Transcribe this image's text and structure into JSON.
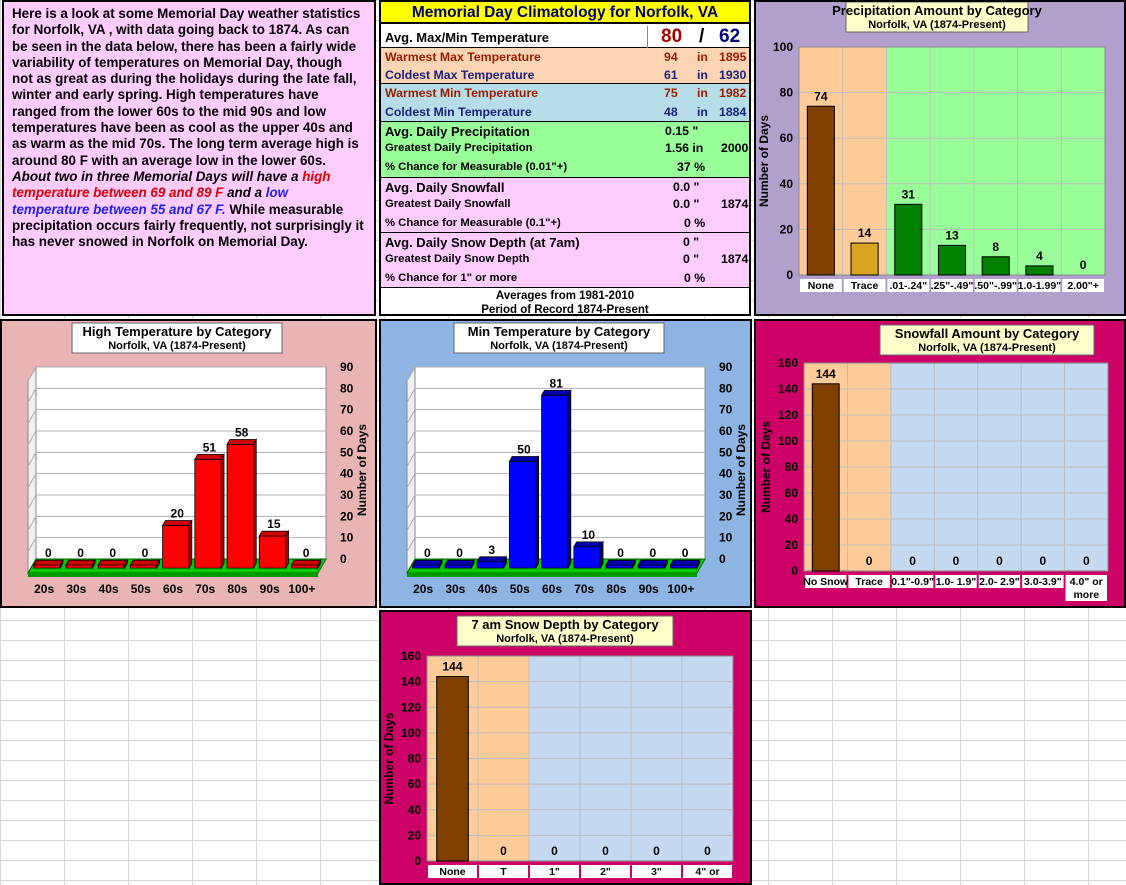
{
  "intro": {
    "part1": "Here is a look at some Memorial Day weather statistics for Norfolk, VA , with data going back to 1874. As can be seen in the data below, there has been a fairly wide variability of temperatures on Memorial Day, though not as great as during the holidays during the late fall, winter and early spring. High temperatures have ranged from the lower 60s to the mid 90s and low temperatures have been as cool as the upper 40s and as warm as the mid 70s. The long term average high is around 80 F with an average low in the lower 60s. ",
    "italic1": "About two in three Memorial Days will have a ",
    "red": "high temperature between 69 and 89 F",
    "italic2": " and a ",
    "blue": "low temperature between 55 and 67 F.",
    "part2": " While measurable precipitation occurs fairly frequently, not surprisingly it has never snowed in Norfolk on Memorial Day."
  },
  "climatology": {
    "title": "Memorial Day Climatology for Norfolk, VA",
    "avg_maxmin_label": "Avg. Max/Min Temperature",
    "avg_max": "80",
    "slash": "/",
    "avg_min": "62",
    "rows_temp": [
      {
        "label": "Warmest Max Temperature",
        "value": "94",
        "in": "in",
        "year": "1895"
      },
      {
        "label": "Coldest Max Temperature",
        "value": "61",
        "in": "in",
        "year": "1930"
      },
      {
        "label": "Warmest Min Temperature",
        "value": "75",
        "in": "in",
        "year": "1982"
      },
      {
        "label": "Coldest Min Temperature",
        "value": "48",
        "in": "in",
        "year": "1884"
      }
    ],
    "precip": {
      "avg_label": "Avg. Daily Precipitation",
      "avg_value": "0.15 \"",
      "greatest_label": "Greatest Daily Precipitation",
      "greatest_value": "1.56 in",
      "greatest_year": "2000",
      "chance_label": "% Chance for Measurable (0.01\"+)",
      "chance_value": "37 %"
    },
    "snow": {
      "avg_label": "Avg. Daily Snowfall",
      "avg_value": "0.0 \"",
      "greatest_label": "Greatest Daily Snowfall",
      "greatest_value": "0.0 \"",
      "greatest_year": "1874",
      "chance_label": "% Chance for Measurable (0.1\"+)",
      "chance_value": "0 %"
    },
    "depth": {
      "avg_label": "Avg. Daily Snow Depth (at 7am)",
      "avg_value": "0 \"",
      "greatest_label": "Greatest Daily Snow Depth",
      "greatest_value": "0 \"",
      "greatest_year": "1874",
      "chance_label": "% Chance for 1\" or more",
      "chance_value": "0 %"
    },
    "footer1": "Averages from 1981-2010",
    "footer2": "Period of Record 1874-Present"
  },
  "colors": {
    "intro_bg": "#ffccff",
    "precip_panel": "#b19fcc",
    "high_panel": "#e8b4b4",
    "min_panel": "#8eb4e3",
    "snow_panel": "#cc0066",
    "precip_green": "#99ff99",
    "trace_orange": "#ffcc99",
    "snow_blue": "#c5d9f1",
    "brown_bar": "#7f3f00",
    "red_bar": "#ff0000",
    "blue_bar": "#0000ff",
    "green_bar": "#008000",
    "gold_bar": "#daa520"
  },
  "chart_data": [
    {
      "type": "bar",
      "title": "Precipitation Amount by Category",
      "subtitle": "Norfolk, VA (1874-Present)",
      "ylabel": "Number of Days",
      "categories": [
        "None",
        "Trace",
        ".01-.24\"",
        ".25\"-.49\"",
        ".50\"-.99\"",
        "1.0-1.99\"",
        "2.00\"+"
      ],
      "values": [
        74,
        14,
        31,
        13,
        8,
        4,
        0
      ],
      "ylim": [
        0,
        100
      ],
      "yticks": [
        "0",
        "20",
        "40",
        "60",
        "80",
        "100"
      ]
    },
    {
      "type": "bar",
      "title": "High Temperature by Category",
      "subtitle": "Norfolk, VA (1874-Present)",
      "ylabel": "Number of Days",
      "categories": [
        "20s",
        "30s",
        "40s",
        "50s",
        "60s",
        "70s",
        "80s",
        "90s",
        "100+"
      ],
      "values": [
        0,
        0,
        0,
        0,
        20,
        51,
        58,
        15,
        0
      ],
      "ylim": [
        0,
        90
      ],
      "yticks": [
        "0",
        "10",
        "20",
        "30",
        "40",
        "50",
        "60",
        "70",
        "80",
        "90"
      ]
    },
    {
      "type": "bar",
      "title": "Min Temperature by Category",
      "subtitle": "Norfolk, VA (1874-Present)",
      "ylabel": "Number of Days",
      "categories": [
        "20s",
        "30s",
        "40s",
        "50s",
        "60s",
        "70s",
        "80s",
        "90s",
        "100+"
      ],
      "values": [
        0,
        0,
        3,
        50,
        81,
        10,
        0,
        0,
        0
      ],
      "ylim": [
        0,
        90
      ],
      "yticks": [
        "0",
        "10",
        "20",
        "30",
        "40",
        "50",
        "60",
        "70",
        "80",
        "90"
      ]
    },
    {
      "type": "bar",
      "title": "Snowfall Amount  by Category",
      "subtitle": "Norfolk, VA (1874-Present)",
      "ylabel": "Number of Days",
      "categories": [
        "No Snow",
        "Trace",
        "0.1\"-0.9\"",
        "1.0- 1.9\"",
        "2.0- 2.9\"",
        "3.0-3.9\"",
        "4.0\" or more"
      ],
      "values": [
        144,
        0,
        0,
        0,
        0,
        0,
        0
      ],
      "ylim": [
        0,
        160
      ],
      "yticks": [
        "0",
        "20",
        "40",
        "60",
        "80",
        "100",
        "120",
        "140",
        "160"
      ]
    },
    {
      "type": "bar",
      "title": "7 am  Snow Depth by Category",
      "subtitle": "Norfolk, VA (1874-Present)",
      "ylabel": "Number of Days",
      "categories": [
        "None",
        "T",
        "1\"",
        "2\"",
        "3\"",
        "4\" or"
      ],
      "values": [
        144,
        0,
        0,
        0,
        0,
        0
      ],
      "ylim": [
        0,
        160
      ],
      "yticks": [
        "0",
        "20",
        "40",
        "60",
        "80",
        "100",
        "120",
        "140",
        "160"
      ]
    }
  ]
}
